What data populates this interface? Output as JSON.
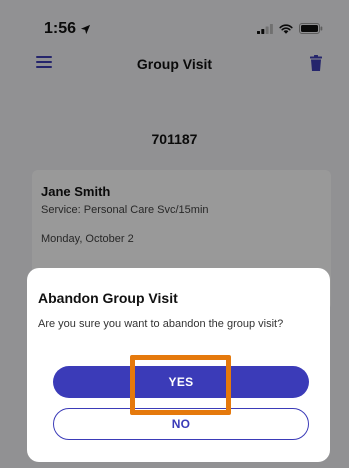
{
  "status_bar": {
    "time": "1:56"
  },
  "nav": {
    "title": "Group Visit"
  },
  "visit": {
    "id": "701187"
  },
  "card": {
    "client_name": "Jane Smith",
    "service": "Service: Personal Care Svc/15min",
    "date": "Monday, October 2"
  },
  "dialog": {
    "title": "Abandon Group Visit",
    "message": "Are you sure you want to abandon the group visit?",
    "yes_label": "YES",
    "no_label": "NO"
  },
  "colors": {
    "accent": "#3b3bb8",
    "highlight": "#e5790c"
  }
}
